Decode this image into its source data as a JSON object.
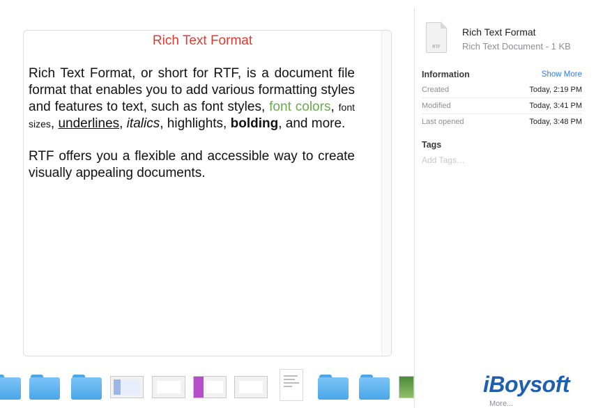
{
  "preview": {
    "title": "Rich Text Format",
    "para1": {
      "s1": "Rich Text Format, or short for RTF, is a document file format that enables you to add various formatting styles and features to text, such as font styles, ",
      "colors": "font colors",
      "s2": ", ",
      "sizes": "font sizes",
      "s3": ", ",
      "underlines": "underlines",
      "s4": ", ",
      "italics": "italics",
      "s5": ", highlights, ",
      "bolding": "bolding",
      "s6": ", and more."
    },
    "para2": "RTF offers you a flexible and accessible way to create visually appealing documents.",
    "accent_color": "#e03a2f",
    "green_color": "#6aab4d"
  },
  "inspector": {
    "file_icon_ext": "RTF",
    "file_name": "Rich Text Format",
    "file_kind": "Rich Text Document - 1 KB",
    "information_heading": "Information",
    "show_more": "Show More",
    "rows": [
      {
        "label": "Created",
        "value": "Today, 2:19 PM"
      },
      {
        "label": "Modified",
        "value": "Today, 3:41 PM"
      },
      {
        "label": "Last opened",
        "value": "Today, 3:48 PM"
      }
    ],
    "tags_heading": "Tags",
    "tags_placeholder": "Add Tags…",
    "link_color": "#2f7bf5"
  },
  "dock": {
    "items": [
      "folder",
      "folder",
      "folder",
      "screenshot",
      "screenshot",
      "screenshot",
      "screenshot",
      "document",
      "folder",
      "folder",
      "image"
    ]
  },
  "branding": {
    "logo": "iBoysoft",
    "more": "More..."
  }
}
